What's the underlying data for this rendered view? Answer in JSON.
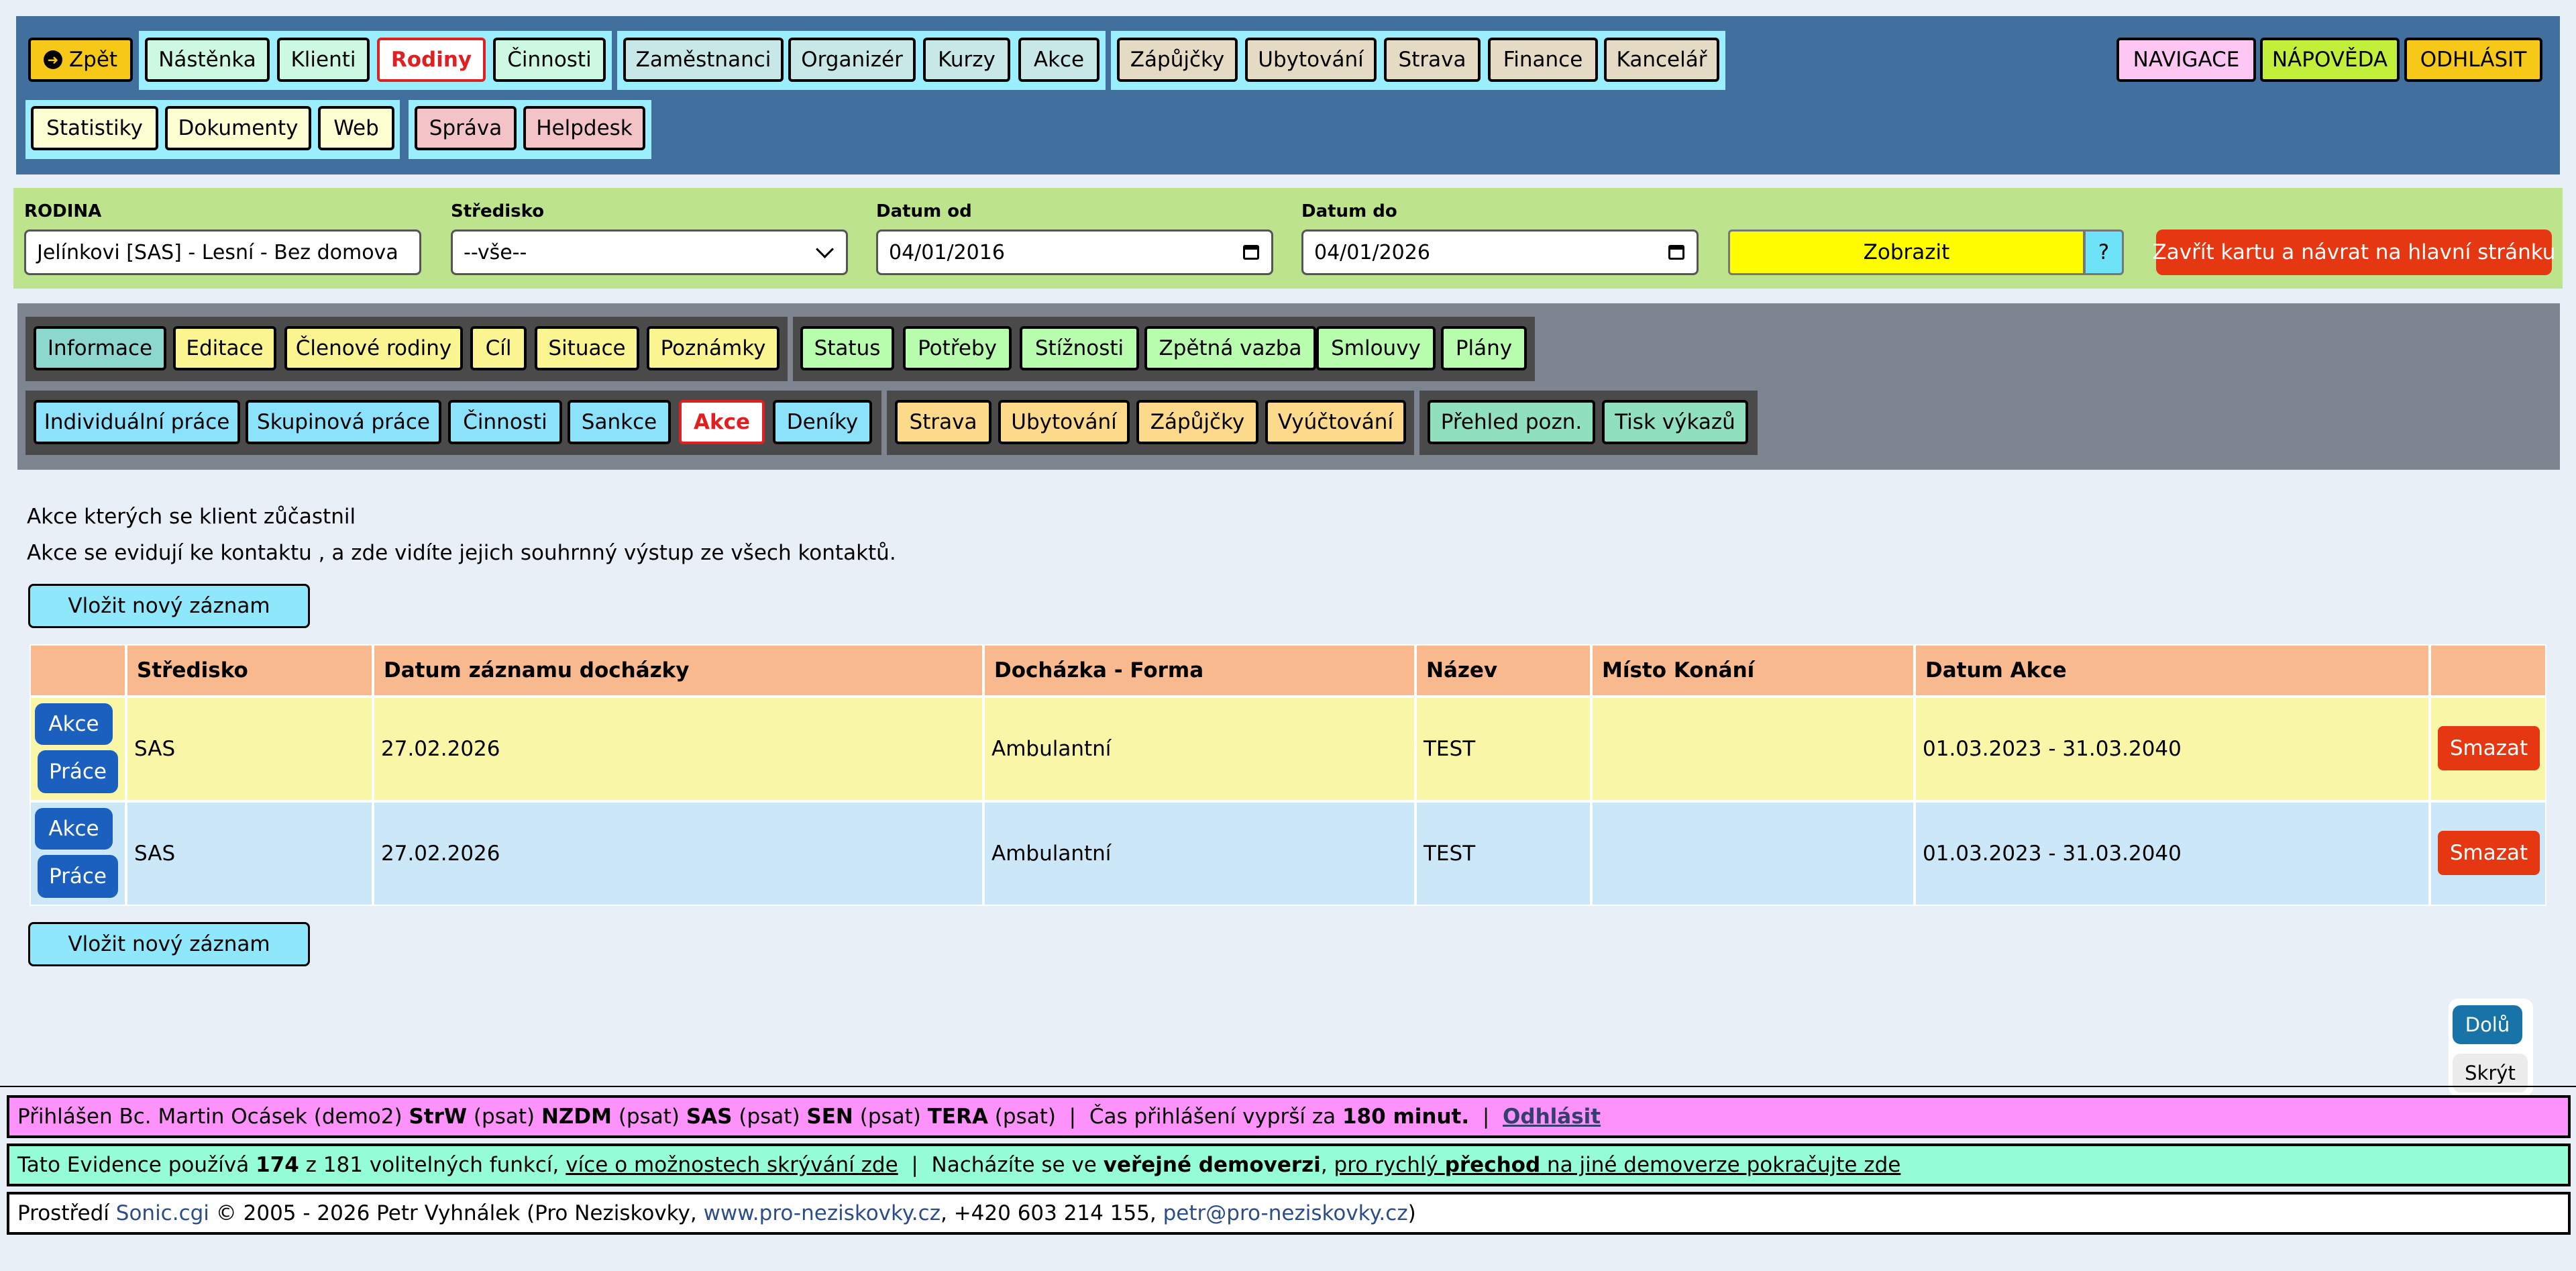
{
  "topnav": {
    "back": "Zpět",
    "row1": [
      "Nástěnka",
      "Klienti",
      "Rodiny",
      "Činnosti",
      "Zaměstnanci",
      "Organizér",
      "Kurzy",
      "Akce",
      "Zápůjčky",
      "Ubytování",
      "Strava",
      "Finance",
      "Kancelář"
    ],
    "row2": [
      "Statistiky",
      "Dokumenty",
      "Web",
      "Správa",
      "Helpdesk"
    ],
    "right": [
      "NAVIGACE",
      "NÁPOVĚDA",
      "ODHLÁSIT"
    ]
  },
  "filters": {
    "rodina_label": "RODINA",
    "rodina_value": "Jelínkovi [SAS] - Lesní - Bez domova",
    "stredisko_label": "Středisko",
    "stredisko_value": "--vše--",
    "datum_od_label": "Datum od",
    "datum_od_value": "04/01/2016",
    "datum_do_label": "Datum do",
    "datum_do_value": "04/01/2026",
    "show_button": "Zobrazit",
    "help_button": "?",
    "close_button": "Zavřít kartu a návrat na hlavní stránku"
  },
  "subnav": {
    "row1": [
      "Informace",
      "Editace",
      "Členové rodiny",
      "Cíl",
      "Situace",
      "Poznámky",
      "Status",
      "Potřeby",
      "Stížnosti",
      "Zpětná vazba",
      "Smlouvy",
      "Plány"
    ],
    "row2": [
      "Individuální práce",
      "Skupinová práce",
      "Činnosti",
      "Sankce",
      "Akce",
      "Deníky",
      "Strava",
      "Ubytování",
      "Zápůjčky",
      "Vyúčtování",
      "Přehled pozn.",
      "Tisk výkazů"
    ]
  },
  "main": {
    "intro1": "Akce kterých se klient zůčastnil",
    "intro2": "Akce se evidují ke kontaktu , a zde vidíte jejich souhrnný výstup ze všech kontaktů.",
    "insert_button": "Vložit nový záznam",
    "columns": [
      "Středisko",
      "Datum záznamu docházky",
      "Docházka - Forma",
      "Název",
      "Místo Konání",
      "Datum Akce"
    ],
    "rows": [
      {
        "akce": "Akce",
        "prace": "Práce",
        "stredisko": "SAS",
        "datum": "27.02.2026",
        "forma": "Ambulantní",
        "nazev": "TEST",
        "misto": "",
        "datum_akce": "01.03.2023 - 31.03.2040",
        "delete": "Smazat"
      },
      {
        "akce": "Akce",
        "prace": "Práce",
        "stredisko": "SAS",
        "datum": "27.02.2026",
        "forma": "Ambulantní",
        "nazev": "TEST",
        "misto": "",
        "datum_akce": "01.03.2023 - 31.03.2040",
        "delete": "Smazat"
      }
    ]
  },
  "float": {
    "down": "Dolů",
    "hide": "Skrýt"
  },
  "footer": {
    "login_prefix": "Přihlášen Bc. Martin Ocásek (demo2)",
    "units": [
      [
        "StrW",
        "(psat)"
      ],
      [
        "NZDM",
        "(psat)"
      ],
      [
        "SAS",
        "(psat)"
      ],
      [
        "SEN",
        "(psat)"
      ],
      [
        "TERA",
        "(psat)"
      ]
    ],
    "session_text": "Čas přihlášení vyprší za",
    "session_minutes": "180 minut.",
    "logout": "Odhlásit",
    "func_prefix": "Tato Evidence používá",
    "func_count": "174",
    "func_suffix": "z 181 volitelných funkcí,",
    "func_link": "více o možnostech skrývání zde",
    "demo_prefix": "Nacházíte se ve",
    "demo_bold": "veřejné demoverzi",
    "demo_link1": "pro rychlý",
    "demo_link_bold": "přechod",
    "demo_link2": "na jiné demoverze pokračujte zde",
    "copyright_prefix": "Prostředí",
    "sonic": "Sonic.cgi",
    "copyright_mid": "© 2005 - 2026 Petr Vyhnálek (Pro Neziskovky,",
    "web": "www.pro-neziskovky.cz",
    "phone": ", +420 603 214 155,",
    "email": "petr@pro-neziskovky.cz",
    "close_paren": ")"
  }
}
